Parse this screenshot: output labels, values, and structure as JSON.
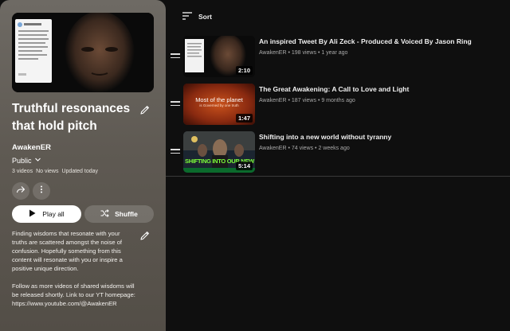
{
  "playlist": {
    "title": "Truthful resonances that hold pitch",
    "owner": "AwakenER",
    "privacy": "Public",
    "stats": [
      "3 videos",
      "No views",
      "Updated today"
    ],
    "play_all_label": "Play all",
    "shuffle_label": "Shuffle",
    "description": {
      "para1": "Finding wisdoms that resonate with your truths are scattered amongst the noise of confusion. Hopefully something from this content will resonate with you or inspire a positive unique direction.",
      "para2": "Follow as more videos of shared wisdoms will be released shortly. Link to our YT homepage:",
      "url": "https://www.youtube.com/@AwakenER"
    }
  },
  "list": {
    "sort_label": "Sort",
    "videos": [
      {
        "title": "An inspired Tweet By Ali Zeck - Produced & Voiced By Jason Ring",
        "channel": "AwakenER",
        "views": "198 views",
        "age": "1 year ago",
        "duration": "2:10"
      },
      {
        "title": "The Great Awakening: A Call to Love and Light",
        "channel": "AwakenER",
        "views": "187 views",
        "age": "9 months ago",
        "duration": "1:47",
        "thumb_text_1": "Most of the planet",
        "thumb_text_2": "is Governed by one truth"
      },
      {
        "title": "Shifting into a new world without tyranny",
        "channel": "AwakenER",
        "views": "74 views",
        "age": "2 weeks ago",
        "duration": "5:14",
        "thumb_text": "SHIFTING INTO OUR NEW WORLD"
      }
    ]
  },
  "colors": {
    "panel_top": "#6e6a64",
    "panel_bottom": "#534e47",
    "background": "#0f0f0f",
    "meta_text": "#aaaaaa"
  }
}
